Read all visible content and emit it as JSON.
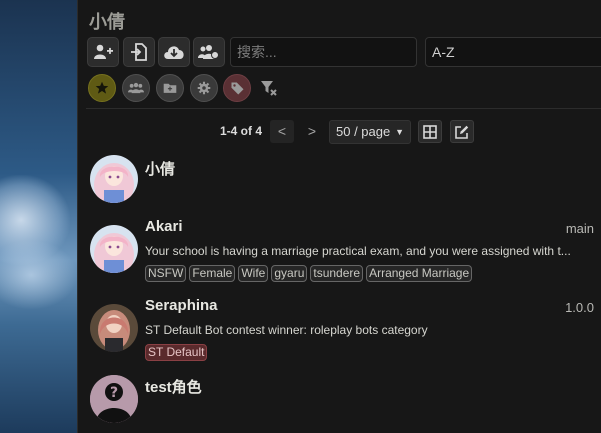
{
  "panel": {
    "title": "小倩",
    "search_placeholder": "搜索...",
    "sort_value": "A-Z"
  },
  "toolbar": {
    "buttons": [
      "create-character-icon",
      "import-file-icon",
      "import-cloud-icon",
      "create-group-icon"
    ]
  },
  "filters": [
    "favorites-star-icon",
    "groups-icon",
    "folder-icon",
    "gear-icon",
    "tag-icon",
    "clear-filter-icon"
  ],
  "pagination": {
    "range_text": "1-4 of 4",
    "prev_label": "<",
    "next_label": ">",
    "per_page": "50 / page"
  },
  "characters": [
    {
      "name": "小倩",
      "version": "",
      "description": "",
      "tags": []
    },
    {
      "name": "Akari",
      "version": "main",
      "description": "Your school is having a marriage practical exam, and you were assigned with t...",
      "tags": [
        "NSFW",
        "Female",
        "Wife",
        "gyaru",
        "tsundere",
        "Arranged Marriage"
      ]
    },
    {
      "name": "Seraphina",
      "version": "1.0.0",
      "description": "ST Default Bot contest winner: roleplay bots category",
      "tags": [
        "ST Default"
      ]
    },
    {
      "name": "test角色",
      "version": "",
      "description": "",
      "tags": []
    }
  ],
  "colors": {
    "accent_tag_red": "#5a2a2c",
    "favorite_active": "#5f5a14"
  }
}
